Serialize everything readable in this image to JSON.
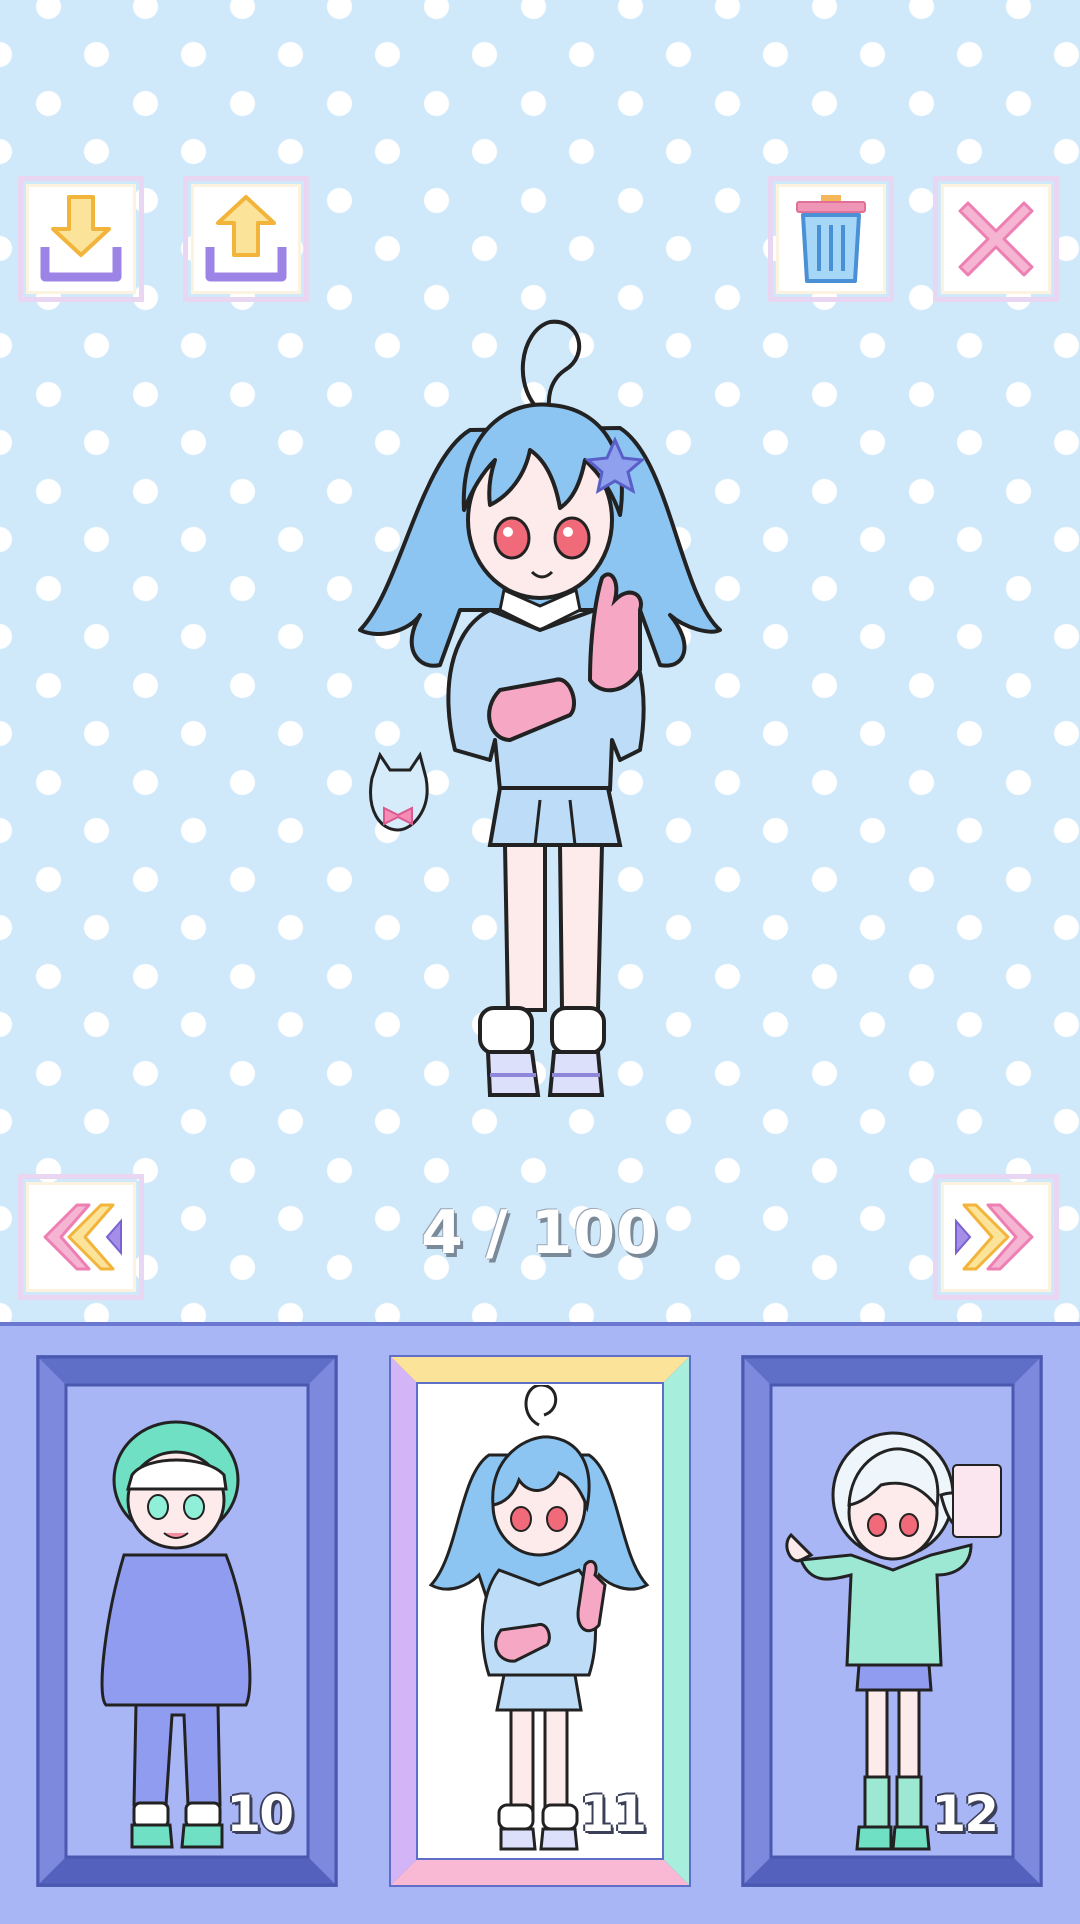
{
  "toolbar": {
    "download_icon": "download-tray-icon",
    "upload_icon": "upload-tray-icon",
    "delete_icon": "trash-icon",
    "close_icon": "close-x-icon"
  },
  "nav": {
    "prev_icon": "double-chevron-left-icon",
    "next_icon": "double-chevron-right-icon"
  },
  "page_counter": "4 / 100",
  "slots": [
    {
      "number": "10",
      "selected": false,
      "hair_color": "#6fe0c4",
      "outfit_color": "#8f9cf0"
    },
    {
      "number": "11",
      "selected": true,
      "hair_color": "#8cc4f2",
      "outfit_color": "#bcdcf7"
    },
    {
      "number": "12",
      "selected": false,
      "hair_color": "#eef6fb",
      "outfit_color": "#9de8d2"
    }
  ],
  "colors": {
    "background": "#cfe9fb",
    "tray": "#a8b6f6",
    "frame_dark": "#5f6fc8"
  }
}
